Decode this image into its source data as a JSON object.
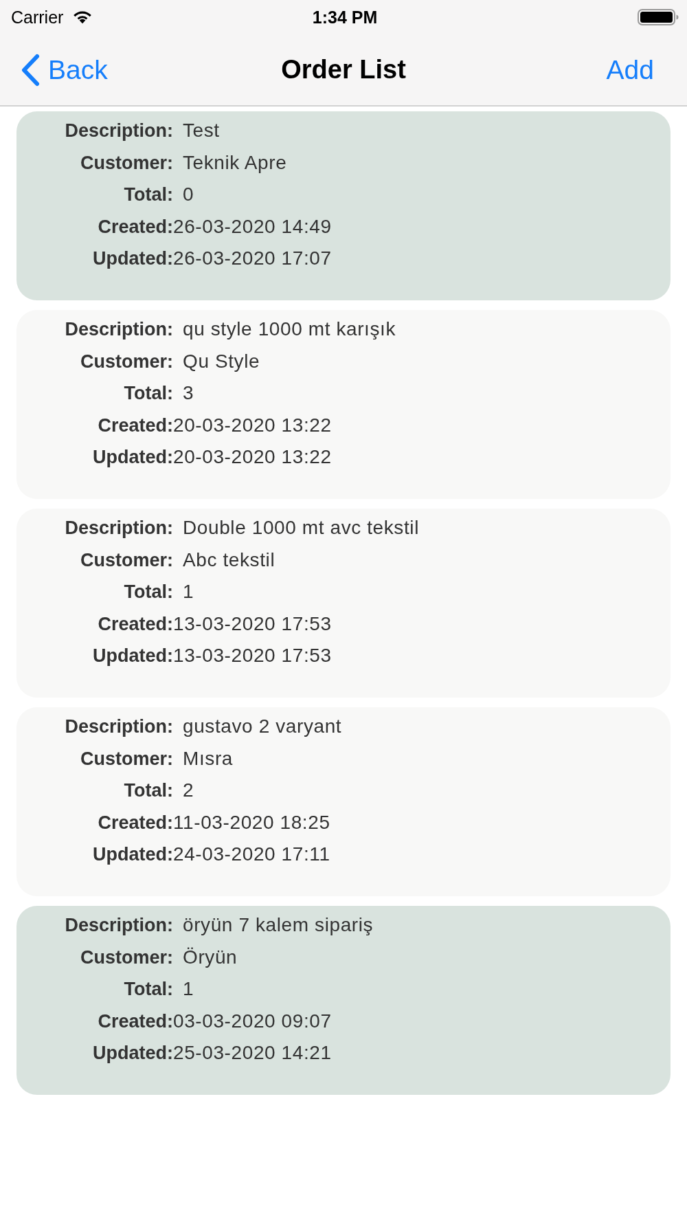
{
  "status_bar": {
    "carrier": "Carrier",
    "time": "1:34 PM"
  },
  "nav_bar": {
    "back": "Back",
    "title": "Order List",
    "action": "Add"
  },
  "orders": [
    {
      "color": "#d9e3de",
      "fields": [
        {
          "kind": "text",
          "label": "Description:",
          "value": "Test"
        },
        {
          "kind": "text",
          "label": "Customer:",
          "value": "Teknik Apre"
        },
        {
          "kind": "text",
          "label": "Total:",
          "value": "0"
        },
        {
          "kind": "timestamp",
          "label": "Created:",
          "value": "26-03-2020 14:49"
        },
        {
          "kind": "timestamp",
          "label": "Updated:",
          "value": "26-03-2020 17:07"
        }
      ]
    },
    {
      "color": "#f8f8f7",
      "fields": [
        {
          "kind": "text",
          "label": "Description:",
          "value": "qu style 1000 mt karışık"
        },
        {
          "kind": "text",
          "label": "Customer:",
          "value": "Qu Style"
        },
        {
          "kind": "text",
          "label": "Total:",
          "value": "3"
        },
        {
          "kind": "timestamp",
          "label": "Created:",
          "value": "20-03-2020 13:22"
        },
        {
          "kind": "timestamp",
          "label": "Updated:",
          "value": "20-03-2020 13:22"
        }
      ]
    },
    {
      "color": "#f8f8f7",
      "fields": [
        {
          "kind": "text",
          "label": "Description:",
          "value": "Double 1000 mt avc tekstil"
        },
        {
          "kind": "text",
          "label": "Customer:",
          "value": "Abc tekstil"
        },
        {
          "kind": "text",
          "label": "Total:",
          "value": "1"
        },
        {
          "kind": "timestamp",
          "label": "Created:",
          "value": "13-03-2020 17:53"
        },
        {
          "kind": "timestamp",
          "label": "Updated:",
          "value": "13-03-2020 17:53"
        }
      ]
    },
    {
      "color": "#f8f8f7",
      "fields": [
        {
          "kind": "text",
          "label": "Description:",
          "value": "gustavo 2 varyant"
        },
        {
          "kind": "text",
          "label": "Customer:",
          "value": "Mısra"
        },
        {
          "kind": "text",
          "label": "Total:",
          "value": "2"
        },
        {
          "kind": "timestamp",
          "label": "Created:",
          "value": "11-03-2020 18:25"
        },
        {
          "kind": "timestamp",
          "label": "Updated:",
          "value": "24-03-2020 17:11"
        }
      ]
    },
    {
      "color": "#d9e3de",
      "fields": [
        {
          "kind": "text",
          "label": "Description:",
          "value": "öryün 7 kalem sipariş"
        },
        {
          "kind": "text",
          "label": "Customer:",
          "value": "Öryün"
        },
        {
          "kind": "text",
          "label": "Total:",
          "value": "1"
        },
        {
          "kind": "timestamp",
          "label": "Created:",
          "value": "03-03-2020 09:07"
        },
        {
          "kind": "timestamp",
          "label": "Updated:",
          "value": "25-03-2020 14:21"
        }
      ]
    }
  ]
}
